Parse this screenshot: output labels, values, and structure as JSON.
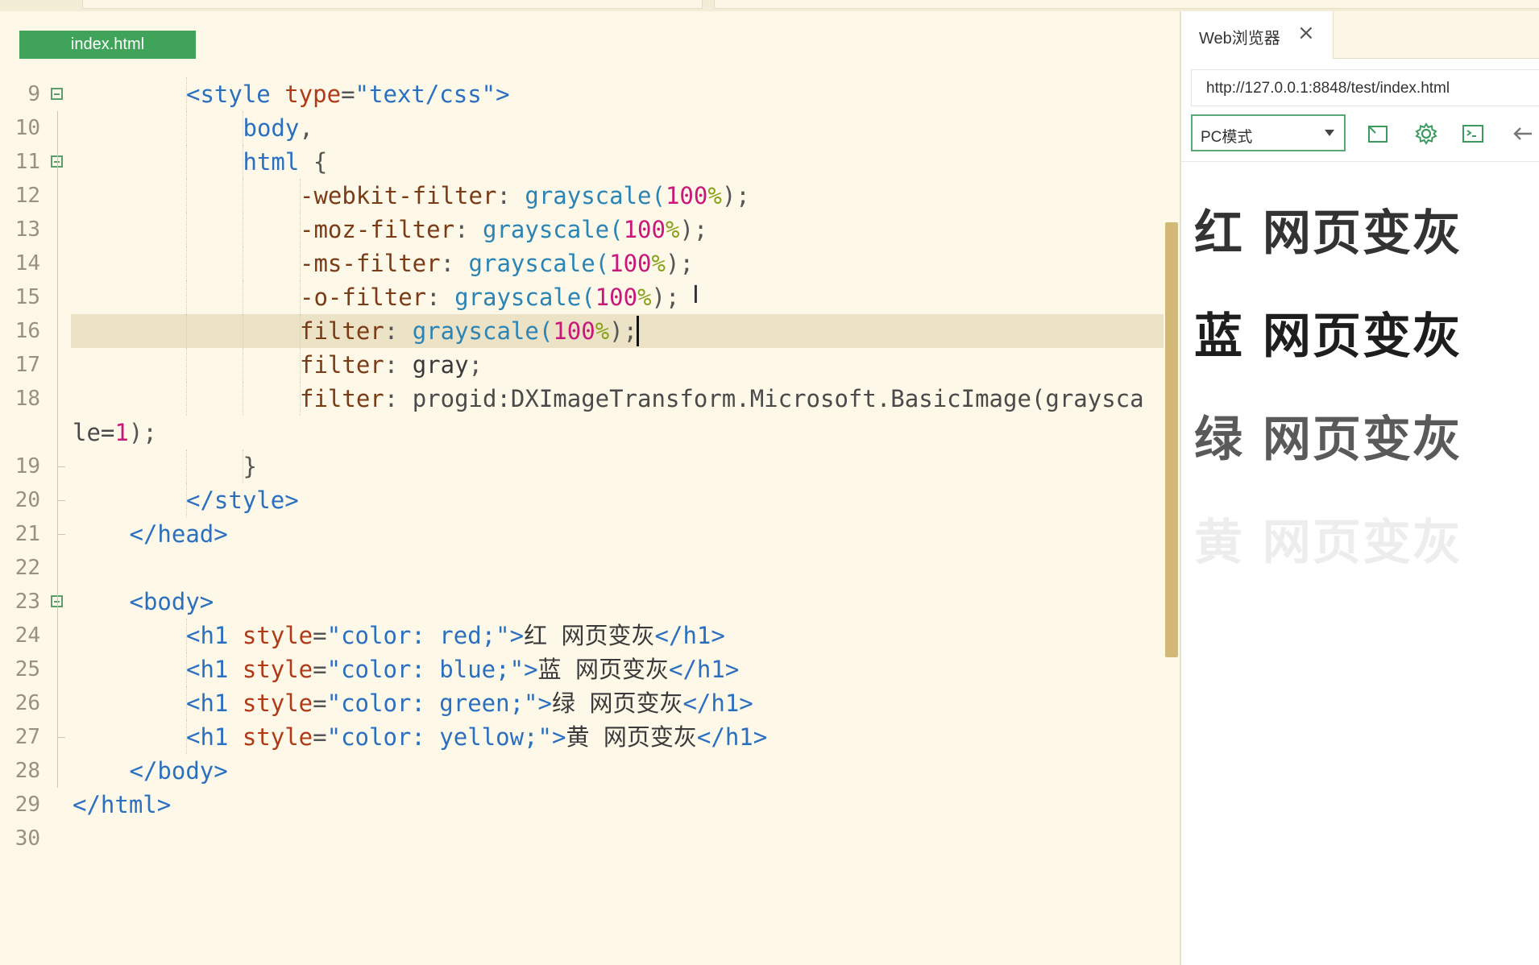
{
  "editor": {
    "file_tab": "index.html",
    "lines": [
      {
        "num": "9",
        "fold": true,
        "indent": 2,
        "tokens": [
          [
            "t-tag",
            "<style "
          ],
          [
            "t-attr",
            "type"
          ],
          [
            "t-p",
            "="
          ],
          [
            "t-str",
            "\"text/css\""
          ],
          [
            "t-tag",
            ">"
          ]
        ]
      },
      {
        "num": "10",
        "fold": false,
        "indent": 3,
        "tokens": [
          [
            "t-tag",
            "body"
          ],
          [
            "t-p",
            ","
          ]
        ]
      },
      {
        "num": "11",
        "fold": true,
        "indent": 3,
        "tokens": [
          [
            "t-tag",
            "html "
          ],
          [
            "t-p",
            "{"
          ]
        ]
      },
      {
        "num": "12",
        "fold": false,
        "indent": 4,
        "tokens": [
          [
            "t-prop",
            "-webkit-filter"
          ],
          [
            "t-p",
            ": "
          ],
          [
            "t-fn",
            "grayscale("
          ],
          [
            "t-num",
            "100"
          ],
          [
            "t-unit",
            "%"
          ],
          [
            "t-p",
            ");"
          ]
        ]
      },
      {
        "num": "13",
        "fold": false,
        "indent": 4,
        "tokens": [
          [
            "t-prop",
            "-moz-filter"
          ],
          [
            "t-p",
            ": "
          ],
          [
            "t-fn",
            "grayscale("
          ],
          [
            "t-num",
            "100"
          ],
          [
            "t-unit",
            "%"
          ],
          [
            "t-p",
            ");"
          ]
        ]
      },
      {
        "num": "14",
        "fold": false,
        "indent": 4,
        "tokens": [
          [
            "t-prop",
            "-ms-filter"
          ],
          [
            "t-p",
            ": "
          ],
          [
            "t-fn",
            "grayscale("
          ],
          [
            "t-num",
            "100"
          ],
          [
            "t-unit",
            "%"
          ],
          [
            "t-p",
            ");"
          ]
        ]
      },
      {
        "num": "15",
        "fold": false,
        "indent": 4,
        "tokens": [
          [
            "t-prop",
            "-o-filter"
          ],
          [
            "t-p",
            ": "
          ],
          [
            "t-fn",
            "grayscale("
          ],
          [
            "t-num",
            "100"
          ],
          [
            "t-unit",
            "%"
          ],
          [
            "t-p",
            ");"
          ]
        ]
      },
      {
        "num": "16",
        "fold": false,
        "indent": 4,
        "tokens": [
          [
            "t-prop",
            "filter"
          ],
          [
            "t-p",
            ": "
          ],
          [
            "t-fn",
            "grayscale("
          ],
          [
            "t-num",
            "100"
          ],
          [
            "t-unit",
            "%"
          ],
          [
            "t-p",
            ");"
          ]
        ]
      },
      {
        "num": "17",
        "fold": false,
        "indent": 4,
        "tokens": [
          [
            "t-prop",
            "filter"
          ],
          [
            "t-p",
            ": "
          ],
          [
            "t-gray",
            "gray"
          ],
          [
            "t-p",
            ";"
          ]
        ]
      },
      {
        "num": "18",
        "fold": false,
        "indent": 4,
        "tokens": [
          [
            "t-prop",
            "filter"
          ],
          [
            "t-p",
            ": "
          ],
          [
            "t-dx",
            "progid:DXImageTransform.Microsoft.BasicImage(graysca"
          ]
        ]
      },
      {
        "num": "",
        "fold": false,
        "indent": 0,
        "tokens": [
          [
            "t-dx",
            "le="
          ],
          [
            "t-num",
            "1"
          ],
          [
            "t-p",
            ");"
          ]
        ]
      },
      {
        "num": "19",
        "fold": false,
        "indent": 3,
        "tokens": [
          [
            "t-p",
            "}"
          ]
        ]
      },
      {
        "num": "20",
        "fold": false,
        "indent": 2,
        "tokens": [
          [
            "t-tag",
            "</style>"
          ]
        ]
      },
      {
        "num": "21",
        "fold": false,
        "indent": 1,
        "tokens": [
          [
            "t-tag",
            "</head>"
          ]
        ]
      },
      {
        "num": "22",
        "fold": false,
        "indent": 0,
        "tokens": []
      },
      {
        "num": "23",
        "fold": true,
        "indent": 1,
        "tokens": [
          [
            "t-tag",
            "<body>"
          ]
        ]
      },
      {
        "num": "24",
        "fold": false,
        "indent": 2,
        "tokens": [
          [
            "t-tag",
            "<h1 "
          ],
          [
            "t-attr",
            "style"
          ],
          [
            "t-p",
            "="
          ],
          [
            "t-str",
            "\"color: red;\""
          ],
          [
            "t-tag",
            ">"
          ],
          [
            "t-gray",
            "红 网页变灰"
          ],
          [
            "t-tag",
            "</h1>"
          ]
        ]
      },
      {
        "num": "25",
        "fold": false,
        "indent": 2,
        "tokens": [
          [
            "t-tag",
            "<h1 "
          ],
          [
            "t-attr",
            "style"
          ],
          [
            "t-p",
            "="
          ],
          [
            "t-str",
            "\"color: blue;\""
          ],
          [
            "t-tag",
            ">"
          ],
          [
            "t-gray",
            "蓝 网页变灰"
          ],
          [
            "t-tag",
            "</h1>"
          ]
        ]
      },
      {
        "num": "26",
        "fold": false,
        "indent": 2,
        "tokens": [
          [
            "t-tag",
            "<h1 "
          ],
          [
            "t-attr",
            "style"
          ],
          [
            "t-p",
            "="
          ],
          [
            "t-str",
            "\"color: green;\""
          ],
          [
            "t-tag",
            ">"
          ],
          [
            "t-gray",
            "绿 网页变灰"
          ],
          [
            "t-tag",
            "</h1>"
          ]
        ]
      },
      {
        "num": "27",
        "fold": false,
        "indent": 2,
        "tokens": [
          [
            "t-tag",
            "<h1 "
          ],
          [
            "t-attr",
            "style"
          ],
          [
            "t-p",
            "="
          ],
          [
            "t-str",
            "\"color: yellow;\""
          ],
          [
            "t-tag",
            ">"
          ],
          [
            "t-gray",
            "黄 网页变灰"
          ],
          [
            "t-tag",
            "</h1>"
          ]
        ]
      },
      {
        "num": "28",
        "fold": false,
        "indent": 1,
        "tokens": [
          [
            "t-tag",
            "</body>"
          ]
        ]
      },
      {
        "num": "29",
        "fold": false,
        "indent": 0,
        "tokens": [
          [
            "t-tag",
            "</html>"
          ]
        ]
      },
      {
        "num": "30",
        "fold": false,
        "indent": 0,
        "tokens": []
      }
    ],
    "current_line": "16"
  },
  "browser": {
    "tab_title": "Web浏览器",
    "close_icon": "×",
    "url": "http://127.0.0.1:8848/test/index.html",
    "mode": "PC模式",
    "toolbar_icons": [
      "external-window-icon",
      "gear-icon",
      "terminal-icon",
      "back-arrow-icon"
    ],
    "headings": [
      {
        "text": "红 网页变灰",
        "color": "#333333"
      },
      {
        "text": "蓝 网页变灰",
        "color": "#1e1e1e"
      },
      {
        "text": "绿 网页变灰",
        "color": "#5a5a5a"
      },
      {
        "text": "黄 网页变灰",
        "color": "#ededed"
      }
    ]
  }
}
